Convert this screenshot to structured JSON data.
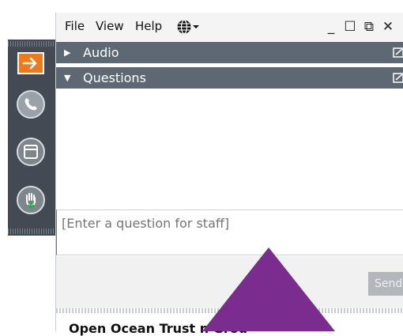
{
  "menu": {
    "file": "File",
    "view": "View",
    "help": "Help",
    "language_icon": "globe-icon"
  },
  "window_controls": {
    "minimize": "_",
    "maximize": "☐",
    "popout": "⧉",
    "close": "✕"
  },
  "sections": {
    "audio": "Audio",
    "questions": "Questions"
  },
  "question_box": {
    "placeholder": "[Enter a question for staff]"
  },
  "send_label": "Send",
  "footer": {
    "org_text": "Open Ocean Trust                    n Grou"
  },
  "colors": {
    "toolbar": "#434a54",
    "accent_orange": "#ef7a1a",
    "section_header": "#5d6874",
    "overlay_purple": "#7b2c8f"
  },
  "toolbar_icons": [
    "arrow-right-icon",
    "phone-icon",
    "window-icon",
    "raise-hand-icon"
  ]
}
